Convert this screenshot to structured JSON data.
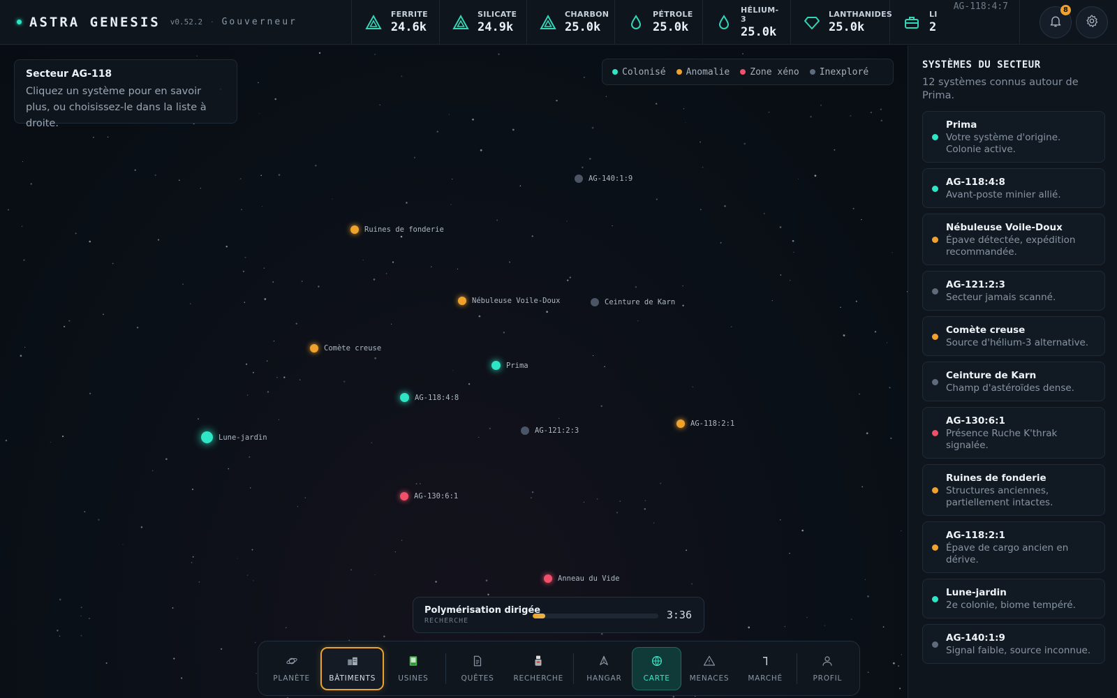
{
  "brand": {
    "name": "ASTRA GENESIS",
    "version": "v0.52.2",
    "separator": "·",
    "role": "Gouverneur"
  },
  "resources": [
    {
      "label": "FERRITE",
      "value": "24.6k",
      "icon": "triangle-ore-icon",
      "color": "#34d6b8"
    },
    {
      "label": "SILICATE",
      "value": "24.9k",
      "icon": "triangle-ore-icon",
      "color": "#34d6b8"
    },
    {
      "label": "CHARBON",
      "value": "25.0k",
      "icon": "triangle-ore-icon",
      "color": "#34d6b8"
    },
    {
      "label": "PÉTROLE",
      "value": "25.0k",
      "icon": "droplet-icon",
      "color": "#34d6b8"
    },
    {
      "label": "HÉLIUM-3",
      "value": "25.0k",
      "icon": "droplet-icon",
      "color": "#34d6b8"
    },
    {
      "label": "LANTHANIDES",
      "value": "25.0k",
      "icon": "gem-icon",
      "color": "#34d6b8"
    }
  ],
  "li": {
    "label": "LI",
    "value": "2",
    "icon": "briefcase-icon"
  },
  "coord": "AG-118:4:7",
  "notifications": {
    "count": "8"
  },
  "info": {
    "title": "Secteur AG-118",
    "desc": "Cliquez un système pour en savoir plus, ou choisissez-le dans la liste à droite."
  },
  "legend": [
    {
      "label": "Colonisé",
      "color": "#2ee6c5"
    },
    {
      "label": "Anomalie",
      "color": "#f0a22c"
    },
    {
      "label": "Zone xéno",
      "color": "#f0506a"
    },
    {
      "label": "Inexploré",
      "color": "#5f6b7c"
    }
  ],
  "map_systems": [
    {
      "name": "AG-140:1:9",
      "status": "inexplore"
    },
    {
      "name": "Ruines de fonderie",
      "status": "anomalie"
    },
    {
      "name": "Nébuleuse Voile-Doux",
      "status": "anomalie"
    },
    {
      "name": "Ceinture de Karn",
      "status": "inexplore"
    },
    {
      "name": "Comète creuse",
      "status": "anomalie"
    },
    {
      "name": "Prima",
      "status": "colonise"
    },
    {
      "name": "AG-118:4:8",
      "status": "colonise"
    },
    {
      "name": "Lune-jardin",
      "status": "colonise"
    },
    {
      "name": "AG-121:2:3",
      "status": "inexplore"
    },
    {
      "name": "AG-118:2:1",
      "status": "anomalie"
    },
    {
      "name": "AG-130:6:1",
      "status": "xeno"
    },
    {
      "name": "Anneau du Vide",
      "status": "xeno"
    }
  ],
  "research": {
    "name": "Polymérisation dirigée",
    "category": "RECHERCHE",
    "progress": 0.1,
    "time": "3:36"
  },
  "nav": [
    {
      "label": "PLANÈTE",
      "icon": "planet-icon"
    },
    {
      "label": "BÂTIMENTS",
      "icon": "buildings-icon"
    },
    {
      "label": "USINES",
      "icon": "factory-icon"
    },
    {
      "label": "QUÊTES",
      "icon": "quests-icon"
    },
    {
      "label": "RECHERCHE",
      "icon": "research-icon"
    },
    {
      "label": "HANGAR",
      "icon": "ship-icon"
    },
    {
      "label": "CARTE",
      "icon": "globe-icon"
    },
    {
      "label": "MENACES",
      "icon": "warning-icon"
    },
    {
      "label": "MARCHÉ",
      "icon": "market-icon"
    },
    {
      "label": "PROFIL",
      "icon": "user-icon"
    }
  ],
  "sidebar": {
    "title": "SYSTÈMES DU SECTEUR",
    "subtitle": "12 systèmes connus autour de Prima.",
    "systems": [
      {
        "name": "Prima",
        "desc": "Votre système d'origine. Colonie active.",
        "status": "colonise"
      },
      {
        "name": "AG-118:4:8",
        "desc": "Avant-poste minier allié.",
        "status": "colonise"
      },
      {
        "name": "Nébuleuse Voile-Doux",
        "desc": "Épave détectée, expédition recommandée.",
        "status": "anomalie"
      },
      {
        "name": "AG-121:2:3",
        "desc": "Secteur jamais scanné.",
        "status": "inexplore"
      },
      {
        "name": "Comète creuse",
        "desc": "Source d'hélium-3 alternative.",
        "status": "anomalie"
      },
      {
        "name": "Ceinture de Karn",
        "desc": "Champ d'astéroïdes dense.",
        "status": "inexplore"
      },
      {
        "name": "AG-130:6:1",
        "desc": "Présence Ruche K'thrak signalée.",
        "status": "xeno"
      },
      {
        "name": "Ruines de fonderie",
        "desc": "Structures anciennes, partiellement intactes.",
        "status": "anomalie"
      },
      {
        "name": "AG-118:2:1",
        "desc": "Épave de cargo ancien en dérive.",
        "status": "anomalie"
      },
      {
        "name": "Lune-jardin",
        "desc": "2e colonie, biome tempéré.",
        "status": "colonise"
      },
      {
        "name": "AG-140:1:9",
        "desc": "Signal faible, source inconnue.",
        "status": "inexplore"
      }
    ]
  },
  "status_colors": {
    "colonise": "#2ee6c5",
    "anomalie": "#f0a22c",
    "xeno": "#f0506a",
    "inexplore": "#5f6b7c"
  }
}
